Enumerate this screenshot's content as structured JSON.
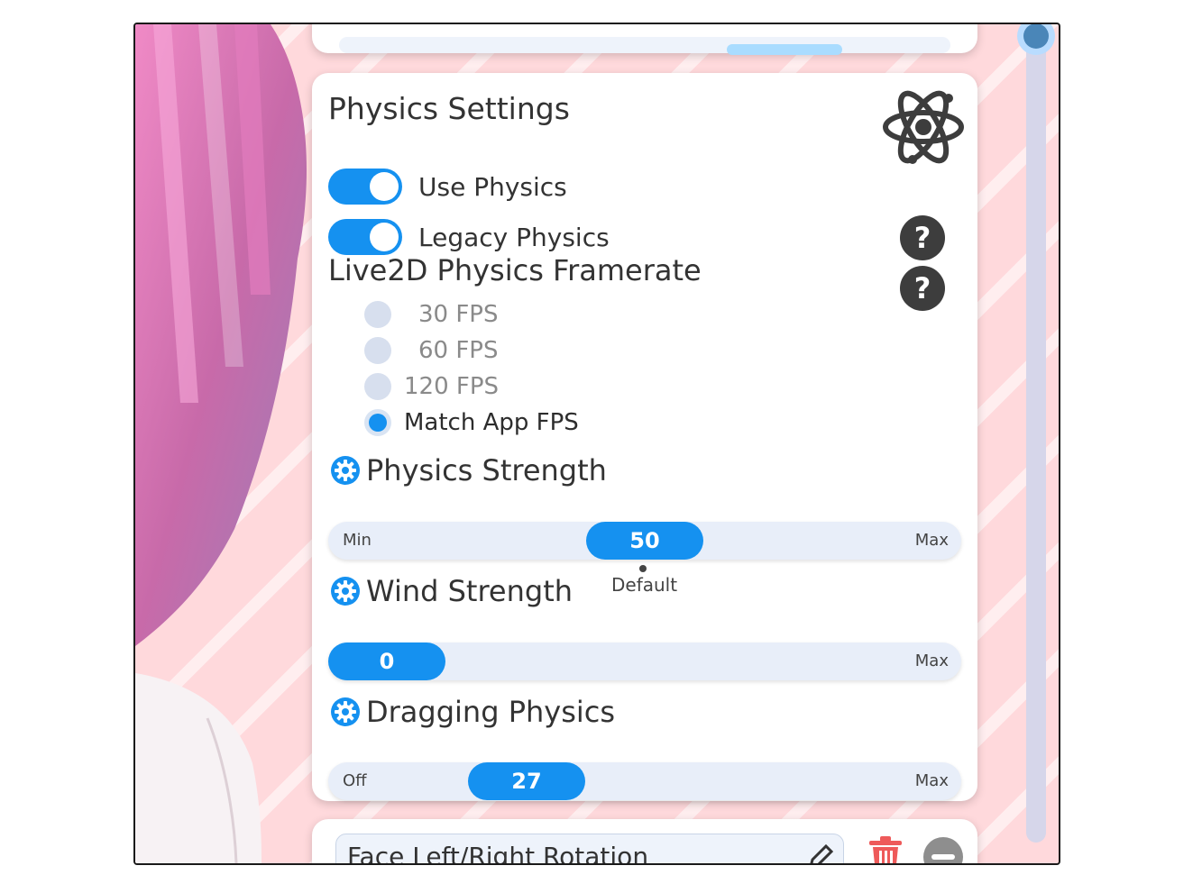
{
  "physics_settings": {
    "title": "Physics Settings",
    "icon": "atom-icon",
    "toggles": [
      {
        "label": "Use Physics",
        "on": true
      },
      {
        "label": "Legacy Physics",
        "on": true
      }
    ],
    "help_icon": "?"
  },
  "framerate": {
    "label": "Live2D Physics Framerate",
    "options": [
      {
        "label": "30 FPS",
        "selected": false
      },
      {
        "label": "60 FPS",
        "selected": false
      },
      {
        "label": "120 FPS",
        "selected": false
      },
      {
        "label": "Match App FPS",
        "selected": true
      }
    ]
  },
  "sliders": {
    "physics_strength": {
      "title": "Physics Strength",
      "min_label": "Min",
      "max_label": "Max",
      "value": "50",
      "default_label": "Default"
    },
    "wind_strength": {
      "title": "Wind Strength",
      "max_label": "Max",
      "value": "0"
    },
    "dragging_physics": {
      "title": "Dragging Physics",
      "min_label": "Off",
      "max_label": "Max",
      "value": "27"
    }
  },
  "next_card": {
    "name_value": "Face Left/Right Rotation",
    "icons": [
      "pencil-icon",
      "trash-icon",
      "minus-icon"
    ]
  },
  "colors": {
    "accent": "#1591f0",
    "background": "#ffd9dc",
    "help": "#3d3d3d"
  }
}
